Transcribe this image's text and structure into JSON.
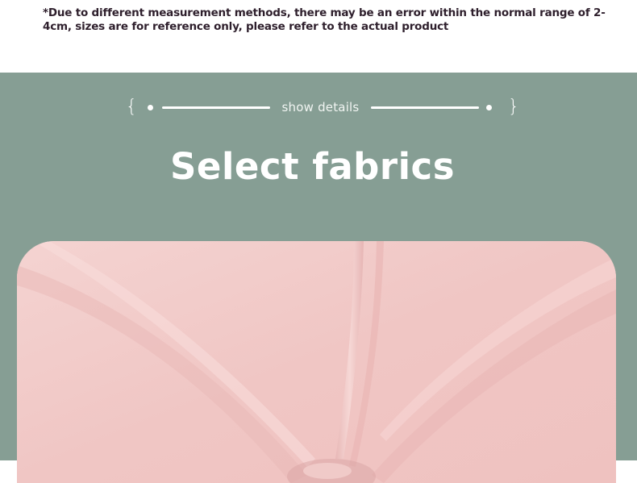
{
  "note": {
    "text": "*Due to different measurement methods, there may be an error within the normal range of 2-4cm, sizes are for reference only, please refer to the actual product"
  },
  "section": {
    "divider_label": "show details",
    "brace_left": "{",
    "brace_right": "}",
    "title": "Select fabrics"
  },
  "fabric_image": {
    "description_icon": "pink-fabric-photo"
  },
  "colors": {
    "band": "#869e94",
    "note_text": "#2e1f2c",
    "fabric": "#f1c9c7"
  }
}
